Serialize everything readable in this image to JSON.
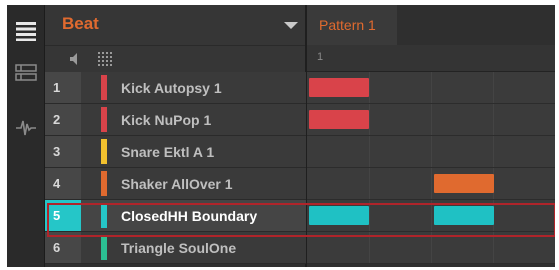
{
  "group": {
    "name": "Beat"
  },
  "pattern": {
    "name": "Pattern 1",
    "ruler_label": "1"
  },
  "colors": {
    "group_name": "#e06a2f",
    "selected": "#25c6c8",
    "highlight_border": "#b0242a",
    "note_red": "#d9434a",
    "note_orange": "#e06a2f",
    "note_cyan": "#1fc1c4"
  },
  "icons": {
    "strip": [
      "list-view-icon",
      "mixer-view-icon",
      "waveform-icon"
    ],
    "sub_row": [
      "speaker-icon",
      "grid-icon"
    ]
  },
  "sounds": [
    {
      "slot": "1",
      "name": "Kick Autopsy 1",
      "color": "#d9434a"
    },
    {
      "slot": "2",
      "name": "Kick NuPop 1",
      "color": "#d9434a"
    },
    {
      "slot": "3",
      "name": "Snare Ektl A 1",
      "color": "#f2c12e"
    },
    {
      "slot": "4",
      "name": "Shaker AllOver 1",
      "color": "#e06a2f"
    },
    {
      "slot": "5",
      "name": "ClosedHH Boundary",
      "color": "#25c6c8",
      "selected": true
    },
    {
      "slot": "6",
      "name": "Triangle SoulOne",
      "color": "#2bbf92"
    }
  ]
}
